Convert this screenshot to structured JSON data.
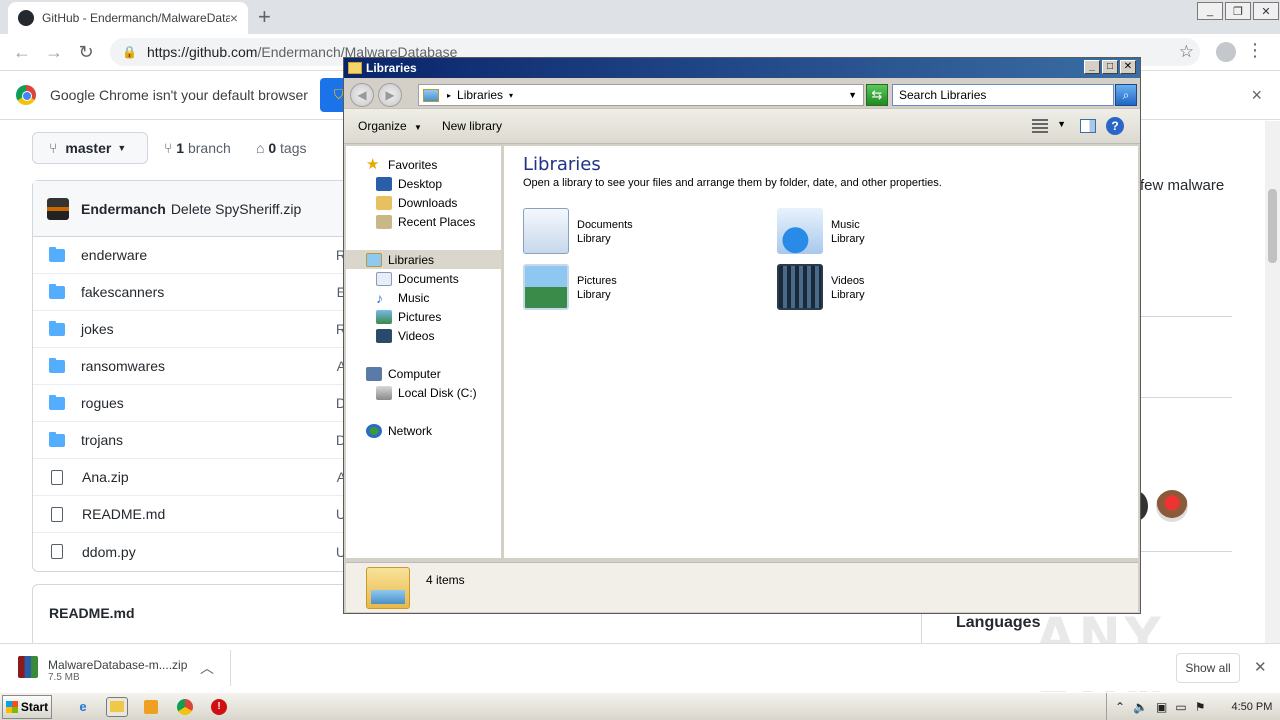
{
  "browser": {
    "tab_title": "GitHub - Endermanch/MalwareDatab",
    "tab_close": "×",
    "new_tab": "+",
    "url_host": "https://github.com",
    "url_path": "/Endermanch/MalwareDatabase",
    "infobar_message": "Google Chrome isn't your default browser",
    "infobar_button": "S",
    "infobar_close": "×"
  },
  "repo": {
    "branch_label": "master",
    "branch_count": "1",
    "branch_word": "branch",
    "tag_count": "0",
    "tag_word": "tags",
    "commit_author": "Endermanch",
    "commit_message": "Delete SpySheriff.zip",
    "files": [
      {
        "name": "enderware",
        "type": "folder",
        "trail": "R"
      },
      {
        "name": "fakescanners",
        "type": "folder",
        "trail": "E"
      },
      {
        "name": "jokes",
        "type": "folder",
        "trail": "R"
      },
      {
        "name": "ransomwares",
        "type": "folder",
        "trail": "A"
      },
      {
        "name": "rogues",
        "type": "folder",
        "trail": "D"
      },
      {
        "name": "trojans",
        "type": "folder",
        "trail": "D"
      },
      {
        "name": "Ana.zip",
        "type": "file",
        "trail": "A"
      },
      {
        "name": "README.md",
        "type": "file",
        "trail": "U"
      },
      {
        "name": "ddom.py",
        "type": "file",
        "trail": "U"
      }
    ],
    "readme_title": "README.md",
    "side_desc": "few malware",
    "languages_heading": "Languages"
  },
  "download": {
    "file_name": "MalwareDatabase-m....zip",
    "file_size": "7.5 MB",
    "show_all": "Show all"
  },
  "watermark": "ANY RUN",
  "explorer": {
    "window_title": "Libraries",
    "address_crumb": "Libraries",
    "search_placeholder": "Search Libraries",
    "organize": "Organize",
    "new_library": "New library",
    "help": "?",
    "nav": {
      "favorites": "Favorites",
      "desktop": "Desktop",
      "downloads": "Downloads",
      "recent_places": "Recent Places",
      "libraries": "Libraries",
      "documents": "Documents",
      "music": "Music",
      "pictures": "Pictures",
      "videos": "Videos",
      "computer": "Computer",
      "local_disk": "Local Disk (C:)",
      "network": "Network"
    },
    "heading": "Libraries",
    "description": "Open a library to see your files and arrange them by folder, date, and other properties.",
    "libraries": [
      {
        "name": "Documents",
        "kind": "Library",
        "icon": "documents-library-icon"
      },
      {
        "name": "Music",
        "kind": "Library",
        "icon": "music-library-icon"
      },
      {
        "name": "Pictures",
        "kind": "Library",
        "icon": "pictures-library-icon"
      },
      {
        "name": "Videos",
        "kind": "Library",
        "icon": "videos-library-icon"
      }
    ],
    "status": "4 items"
  },
  "taskbar": {
    "start": "Start",
    "clock": "4:50 PM"
  }
}
